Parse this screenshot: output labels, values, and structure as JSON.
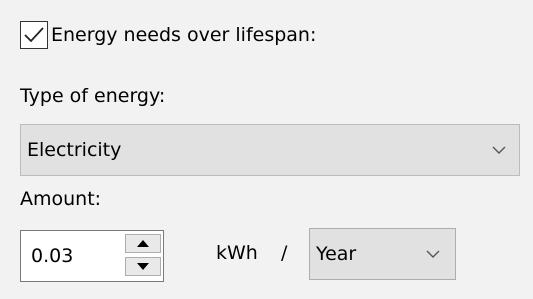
{
  "energy_needs": {
    "checked": true,
    "label": "Energy needs over lifespan:"
  },
  "type_of_energy": {
    "label": "Type of energy:",
    "selected": "Electricity"
  },
  "amount": {
    "label": "Amount:",
    "value": "0.03",
    "unit": "kWh",
    "separator": "/",
    "period_selected": "Year"
  },
  "icons": {
    "checkmark": "checkmark-icon",
    "dropdown": "chevron-down-icon",
    "spin_up": "triangle-up-icon",
    "spin_down": "triangle-down-icon"
  },
  "colors": {
    "background": "#f2f2f2",
    "dropdown_bg": "#e1e1e1",
    "input_bg": "#ffffff"
  }
}
